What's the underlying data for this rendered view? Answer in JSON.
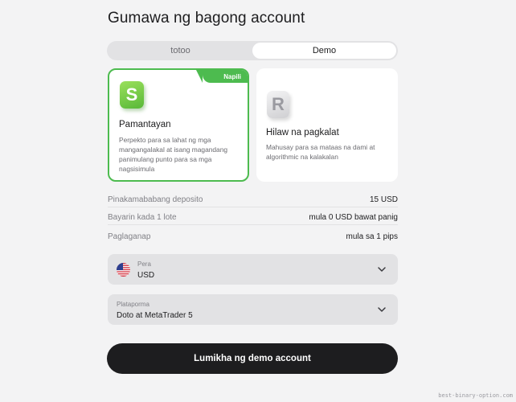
{
  "page_title": "Gumawa ng bagong account",
  "tabs": [
    {
      "label": "totoo",
      "active": false
    },
    {
      "label": "Demo",
      "active": true
    }
  ],
  "cards": {
    "standard": {
      "badge": "Napili",
      "logo_letter": "S",
      "title": "Pamantayan",
      "description": "Perpekto para sa lahat ng mga mangangalakal at isang magandang panimulang punto para sa mga nagsisimula"
    },
    "raw": {
      "logo_letter": "R",
      "title": "Hilaw na pagkalat",
      "description": "Mahusay para sa mataas na dami at algorithmic na kalakalan"
    }
  },
  "info": [
    {
      "label": "Pinakamababang deposito",
      "value": "15 USD"
    },
    {
      "label": "Bayarin kada 1 lote",
      "value": "mula 0 USD bawat panig"
    },
    {
      "label": "Paglaganap",
      "value": "mula sa 1 pips"
    }
  ],
  "currency": {
    "label": "Pera",
    "value": "USD",
    "icon": "us-flag-icon"
  },
  "platform": {
    "label": "Plataporma",
    "value": "Doto at MetaTrader 5"
  },
  "cta_label": "Lumikha ng demo account",
  "watermark": "best-binary-option.com",
  "colors": {
    "accent_green": "#4dbb4f",
    "cta_bg": "#1d1d1f",
    "page_bg": "#f3f3f4"
  }
}
